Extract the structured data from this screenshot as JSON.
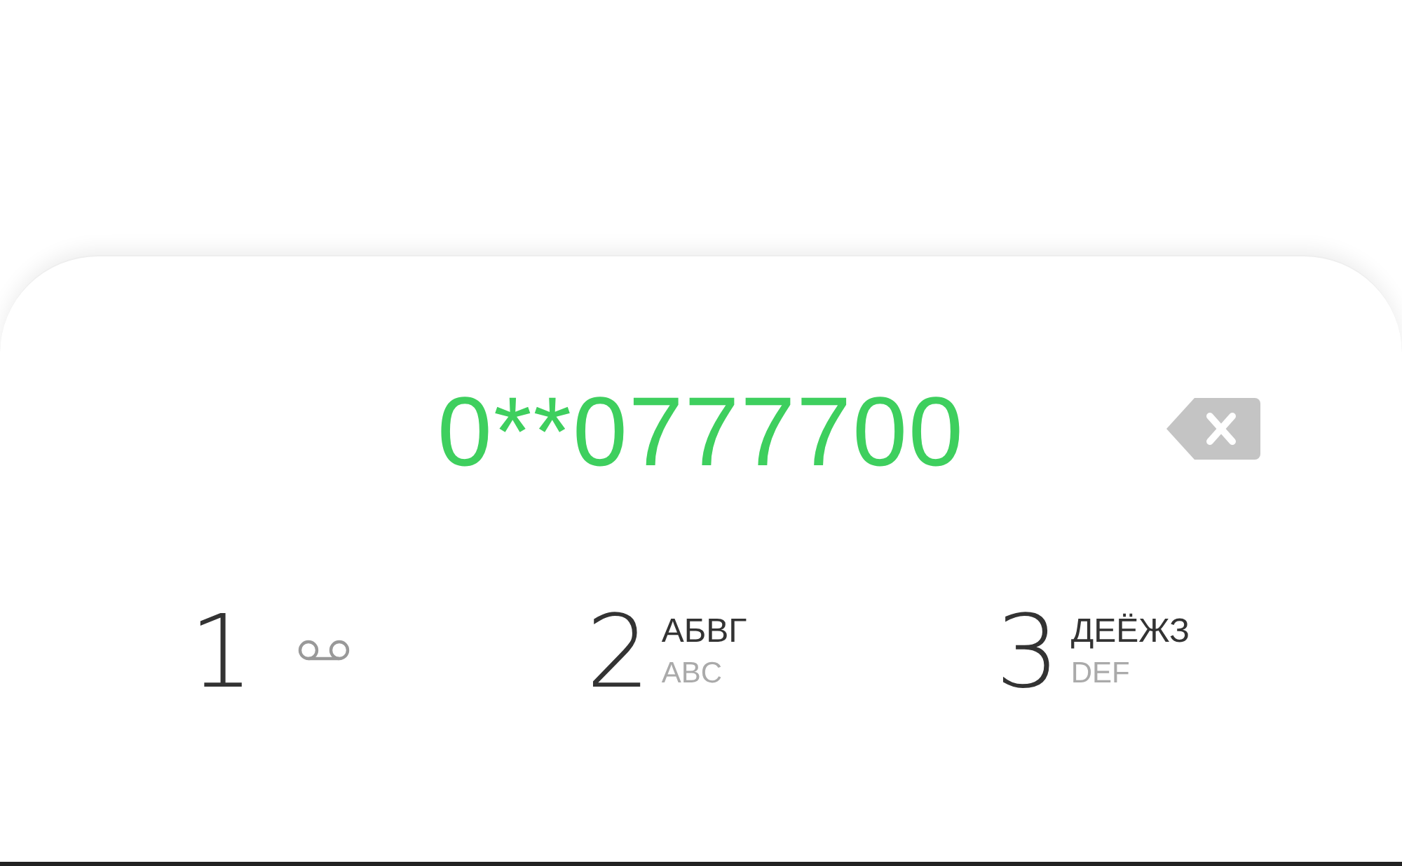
{
  "dialer": {
    "number": "0**0777700",
    "keys": [
      {
        "digit": "1",
        "kind": "voicemail"
      },
      {
        "digit": "2",
        "kind": "letters",
        "letters": "АБВГ",
        "latin": "ABC"
      },
      {
        "digit": "3",
        "kind": "letters",
        "letters": "ДЕЁЖЗ",
        "latin": "DEF"
      }
    ]
  }
}
